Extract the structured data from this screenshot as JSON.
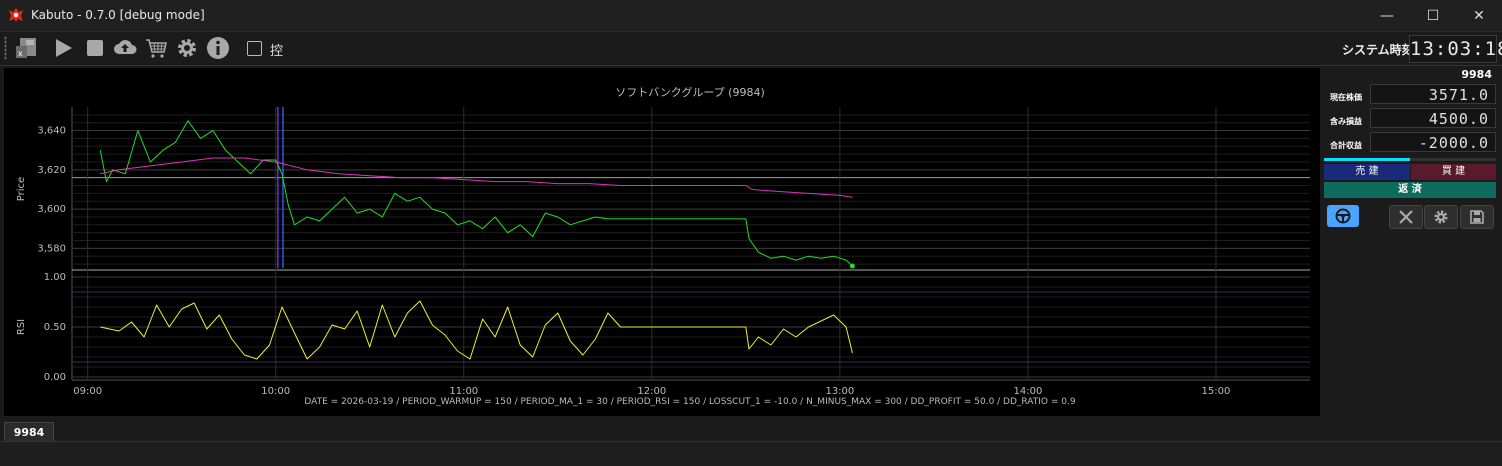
{
  "window": {
    "title": "Kabuto - 0.7.0 [debug mode]",
    "minimize": "—",
    "maximize": "☐",
    "close": "✕"
  },
  "toolbar": {
    "icons": [
      "excel-icon",
      "play-icon",
      "stop-icon",
      "upload-icon",
      "cart-icon",
      "gear-icon",
      "info-icon"
    ],
    "checkbox_label": "控",
    "checkbox_checked": false,
    "system_time_label": "システム時刻",
    "clock": "13:03:18"
  },
  "chart_data": {
    "type": "line",
    "title": "ソフトバンクグループ (9984)",
    "footer": "DATE = 2026-03-19 / PERIOD_WARMUP = 150 / PERIOD_MA_1 = 30 / PERIOD_RSI = 150 / LOSSCUT_1 = -10.0 / N_MINUS_MAX = 300 / DD_PROFIT = 50.0 / DD_RATIO = 0.9",
    "x_ticks": [
      "09:00",
      "10:00",
      "11:00",
      "12:00",
      "13:00",
      "14:00",
      "15:00"
    ],
    "x_range": [
      "08:55",
      "15:30"
    ],
    "price_panel": {
      "ylabel": "Price",
      "y_ticks": [
        "3,640",
        "3,620",
        "3,600",
        "3,580"
      ],
      "ylim": [
        3570,
        3652
      ],
      "reference_line": 3616,
      "series": [
        {
          "color": "#22dd22",
          "x": [
            "09:04",
            "09:06",
            "09:08",
            "09:12",
            "09:16",
            "09:20",
            "09:24",
            "09:28",
            "09:32",
            "09:36",
            "09:40",
            "09:44",
            "09:48",
            "09:52",
            "09:56",
            "10:00",
            "10:02",
            "10:04",
            "10:06",
            "10:10",
            "10:14",
            "10:18",
            "10:22",
            "10:26",
            "10:30",
            "10:34",
            "10:38",
            "10:42",
            "10:46",
            "10:50",
            "10:54",
            "10:58",
            "11:02",
            "11:06",
            "11:10",
            "11:14",
            "11:18",
            "11:22",
            "11:26",
            "11:30",
            "11:34",
            "11:38",
            "11:42",
            "11:46",
            "11:50",
            "11:54",
            "11:58",
            "12:02",
            "12:06",
            "12:10",
            "12:14",
            "12:18",
            "12:22",
            "12:26",
            "12:30",
            "12:31",
            "12:34",
            "12:38",
            "12:42",
            "12:46",
            "12:50",
            "12:54",
            "12:58",
            "13:02",
            "13:04"
          ],
          "values": [
            3630,
            3614,
            3620,
            3618,
            3640,
            3624,
            3630,
            3634,
            3645,
            3636,
            3640,
            3630,
            3624,
            3618,
            3625,
            3625,
            3618,
            3602,
            3592,
            3596,
            3594,
            3600,
            3606,
            3598,
            3600,
            3596,
            3608,
            3604,
            3606,
            3600,
            3598,
            3592,
            3594,
            3590,
            3596,
            3588,
            3592,
            3586,
            3598,
            3596,
            3592,
            3594,
            3596,
            3595,
            3595,
            3595,
            3595,
            3595,
            3595,
            3595,
            3595,
            3595,
            3595,
            3595,
            3595,
            3585,
            3578,
            3575,
            3576,
            3574,
            3576,
            3575,
            3576,
            3574,
            3571
          ]
        },
        {
          "color": "#dd33bb",
          "x": [
            "09:04",
            "09:10",
            "09:20",
            "09:30",
            "09:40",
            "09:50",
            "10:00",
            "10:10",
            "10:20",
            "10:30",
            "10:40",
            "10:50",
            "11:00",
            "11:10",
            "11:20",
            "11:30",
            "11:40",
            "11:50",
            "12:00",
            "12:10",
            "12:20",
            "12:30",
            "12:32",
            "12:40",
            "12:50",
            "13:00",
            "13:04"
          ],
          "values": [
            3618,
            3620,
            3622,
            3624,
            3626,
            3626,
            3624,
            3620,
            3618,
            3617,
            3616,
            3616,
            3615,
            3614,
            3614,
            3613,
            3613,
            3612,
            3612,
            3612,
            3612,
            3612,
            3610,
            3609,
            3608,
            3607,
            3606
          ]
        }
      ]
    },
    "rsi_panel": {
      "ylabel": "RSI",
      "y_ticks": [
        "1.00",
        "0.50",
        "0.00"
      ],
      "ylim": [
        -0.03,
        1.03
      ],
      "series": [
        {
          "color": "#eeee33",
          "x": [
            "09:04",
            "09:10",
            "09:14",
            "09:18",
            "09:22",
            "09:26",
            "09:30",
            "09:34",
            "09:38",
            "09:42",
            "09:46",
            "09:50",
            "09:54",
            "09:58",
            "10:02",
            "10:06",
            "10:10",
            "10:14",
            "10:18",
            "10:22",
            "10:26",
            "10:30",
            "10:34",
            "10:38",
            "10:42",
            "10:46",
            "10:50",
            "10:54",
            "10:58",
            "11:02",
            "11:06",
            "11:10",
            "11:14",
            "11:18",
            "11:22",
            "11:26",
            "11:30",
            "11:34",
            "11:38",
            "11:42",
            "11:46",
            "11:50",
            "11:54",
            "11:58",
            "12:02",
            "12:06",
            "12:10",
            "12:14",
            "12:18",
            "12:22",
            "12:26",
            "12:30",
            "12:31",
            "12:34",
            "12:38",
            "12:42",
            "12:46",
            "12:50",
            "12:54",
            "12:58",
            "13:02",
            "13:04"
          ],
          "values": [
            0.5,
            0.46,
            0.55,
            0.4,
            0.72,
            0.5,
            0.68,
            0.74,
            0.48,
            0.62,
            0.38,
            0.22,
            0.18,
            0.32,
            0.7,
            0.44,
            0.18,
            0.3,
            0.52,
            0.48,
            0.66,
            0.3,
            0.72,
            0.4,
            0.64,
            0.76,
            0.52,
            0.42,
            0.26,
            0.18,
            0.58,
            0.4,
            0.7,
            0.32,
            0.2,
            0.52,
            0.64,
            0.36,
            0.22,
            0.38,
            0.64,
            0.5,
            0.5,
            0.5,
            0.5,
            0.5,
            0.5,
            0.5,
            0.5,
            0.5,
            0.5,
            0.5,
            0.28,
            0.4,
            0.32,
            0.48,
            0.4,
            0.5,
            0.56,
            0.62,
            0.5,
            0.24
          ]
        }
      ]
    },
    "vertical_markers": [
      "10:01",
      "10:02"
    ]
  },
  "side_panel": {
    "code": "9984",
    "rows": [
      {
        "label": "現在株価",
        "value": "3571.0"
      },
      {
        "label": "含み損益",
        "value": "4500.0"
      },
      {
        "label": "合計収益",
        "value": "-2000.0"
      }
    ],
    "progress": 0.5,
    "sell_button": "売 建",
    "buy_button": "買 建",
    "repay_button": "返 済",
    "icons": [
      "steering-wheel-icon",
      "tools-icon",
      "gear-icon",
      "save-icon"
    ]
  },
  "bottom": {
    "tab": "9984"
  },
  "colors": {
    "sell": "#1a2a7a",
    "buy": "#5a1a2e",
    "repay": "#0f6b5c",
    "active": "#4aa3ff"
  }
}
